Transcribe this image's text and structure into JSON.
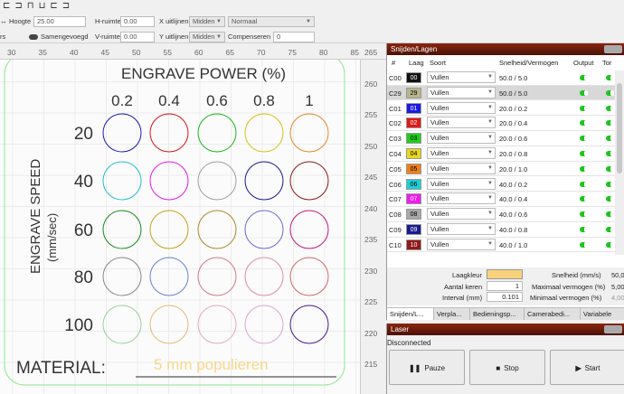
{
  "toolbar": {
    "icons": [
      "align-left-icon",
      "align-center-icon",
      "align-right-icon",
      "align-top-icon",
      "align-middle-icon",
      "align-bottom-icon"
    ],
    "height_label": "Hoogte",
    "height_value": "25.00",
    "hspace_label": "H-ruimte",
    "hspace_value": "0.00",
    "xalign_label": "X uitlijnen",
    "xalign_value": "Midden",
    "style_value": "Normaal",
    "left_cut": "rs",
    "merged_label": "Samengevoegd",
    "vspace_label": "V-ruimte",
    "vspace_value": "0.00",
    "yalign_label": "Y uitlijnen",
    "yalign_value": "Midden",
    "compensate_label": "Compenseren",
    "compensate_value": "0"
  },
  "ruler_top": [
    "30",
    "35",
    "40",
    "45",
    "50",
    "55",
    "60",
    "65",
    "70",
    "75",
    "80",
    "85"
  ],
  "ruler_right": [
    "265",
    "260",
    "255",
    "250",
    "245",
    "240",
    "235",
    "230",
    "225",
    "220",
    "215"
  ],
  "canvas": {
    "title": "ENGRAVE POWER (%)",
    "powers": [
      "0.2",
      "0.4",
      "0.6",
      "0.8",
      "1"
    ],
    "speed_label": "ENGRAVE SPEED",
    "speed_unit": "(mm/sec)",
    "speeds": [
      "20",
      "40",
      "60",
      "80",
      "100"
    ],
    "material_label": "MATERIAL:",
    "material_value": "5 mm populieren",
    "circle_colors": [
      [
        "#1a1ab5",
        "#d01818",
        "#1eb81e",
        "#d8c21a",
        "#e08a2a"
      ],
      [
        "#1ec0d0",
        "#e81ae8",
        "#a0a0a0",
        "#1a1a8a",
        "#8a1a1a"
      ],
      [
        "#1a8a1a",
        "#c8a01a",
        "#a88a2a",
        "#6a6ad8",
        "#c01a7a"
      ],
      [
        "#888888",
        "#6a82d0",
        "#d07a8a",
        "#e08ab0",
        "#d06a6a"
      ],
      [
        "#9ad09a",
        "#e8b87a",
        "#e8a8b8",
        "#d8a8d0",
        "#4a1a8a"
      ]
    ]
  },
  "cuts_panel": {
    "title": "Snijden/Lagen",
    "headers": [
      "#",
      "Laag",
      "Soort",
      "Snelheid/Vermogen",
      "Output",
      "Tor"
    ],
    "rows": [
      {
        "id": "C00",
        "swatch": "00",
        "color": "#111111",
        "text_color": "#ffffff",
        "mode": "Vullen",
        "sp": "50.0 / 5.0"
      },
      {
        "id": "C29",
        "swatch": "29",
        "color": "#b6b68a",
        "text_color": "#000000",
        "mode": "Vullen",
        "sp": "50.0 / 5.0"
      },
      {
        "id": "C01",
        "swatch": "01",
        "color": "#1a1ae0",
        "text_color": "#ffffff",
        "mode": "Vullen",
        "sp": "20.0 / 0.2"
      },
      {
        "id": "C02",
        "swatch": "02",
        "color": "#e01a1a",
        "text_color": "#ffffff",
        "mode": "Vullen",
        "sp": "20.0 / 0.4"
      },
      {
        "id": "C03",
        "swatch": "03",
        "color": "#1ad01a",
        "text_color": "#000000",
        "mode": "Vullen",
        "sp": "20.0 / 0.6"
      },
      {
        "id": "C04",
        "swatch": "04",
        "color": "#e8d81a",
        "text_color": "#000000",
        "mode": "Vullen",
        "sp": "20.0 / 0.8"
      },
      {
        "id": "C05",
        "swatch": "05",
        "color": "#f0801a",
        "text_color": "#000000",
        "mode": "Vullen",
        "sp": "20.0 / 1.0"
      },
      {
        "id": "C06",
        "swatch": "06",
        "color": "#1ad0d8",
        "text_color": "#000000",
        "mode": "Vullen",
        "sp": "40.0 / 0.2"
      },
      {
        "id": "C07",
        "swatch": "07",
        "color": "#f01af0",
        "text_color": "#ffffff",
        "mode": "Vullen",
        "sp": "40.0 / 0.4"
      },
      {
        "id": "C08",
        "swatch": "08",
        "color": "#a8a8a8",
        "text_color": "#000000",
        "mode": "Vullen",
        "sp": "40.0 / 0.6"
      },
      {
        "id": "C09",
        "swatch": "09",
        "color": "#1a1a90",
        "text_color": "#ffffff",
        "mode": "Vullen",
        "sp": "40.0 / 0.8"
      },
      {
        "id": "C10",
        "swatch": "10",
        "color": "#901a1a",
        "text_color": "#ffffff",
        "mode": "Vullen",
        "sp": "40.0 / 1.0"
      }
    ],
    "layer_color_label": "Laagkleur",
    "layer_color_value": "#f7d27a",
    "speed_label": "Snelheid (mm/s)",
    "speed_value": "50,0",
    "passes_label": "Aantal keren",
    "passes_value": "1",
    "max_power_label": "Maximaal vermogen (%)",
    "max_power_value": "5,00",
    "interval_label": "Interval (mm)",
    "interval_value": "0.101",
    "min_power_label": "Minimaal vermogen (%)",
    "min_power_value": "4,00",
    "tabs": [
      "Snijden/L...",
      "Verpla...",
      "Bedieningsp...",
      "Camerabedi...",
      "Variabele"
    ]
  },
  "laser_panel": {
    "title": "Laser",
    "status": "Disconnected",
    "pause_label": "Pauze",
    "stop_label": "Stop",
    "start_label": "Start"
  }
}
